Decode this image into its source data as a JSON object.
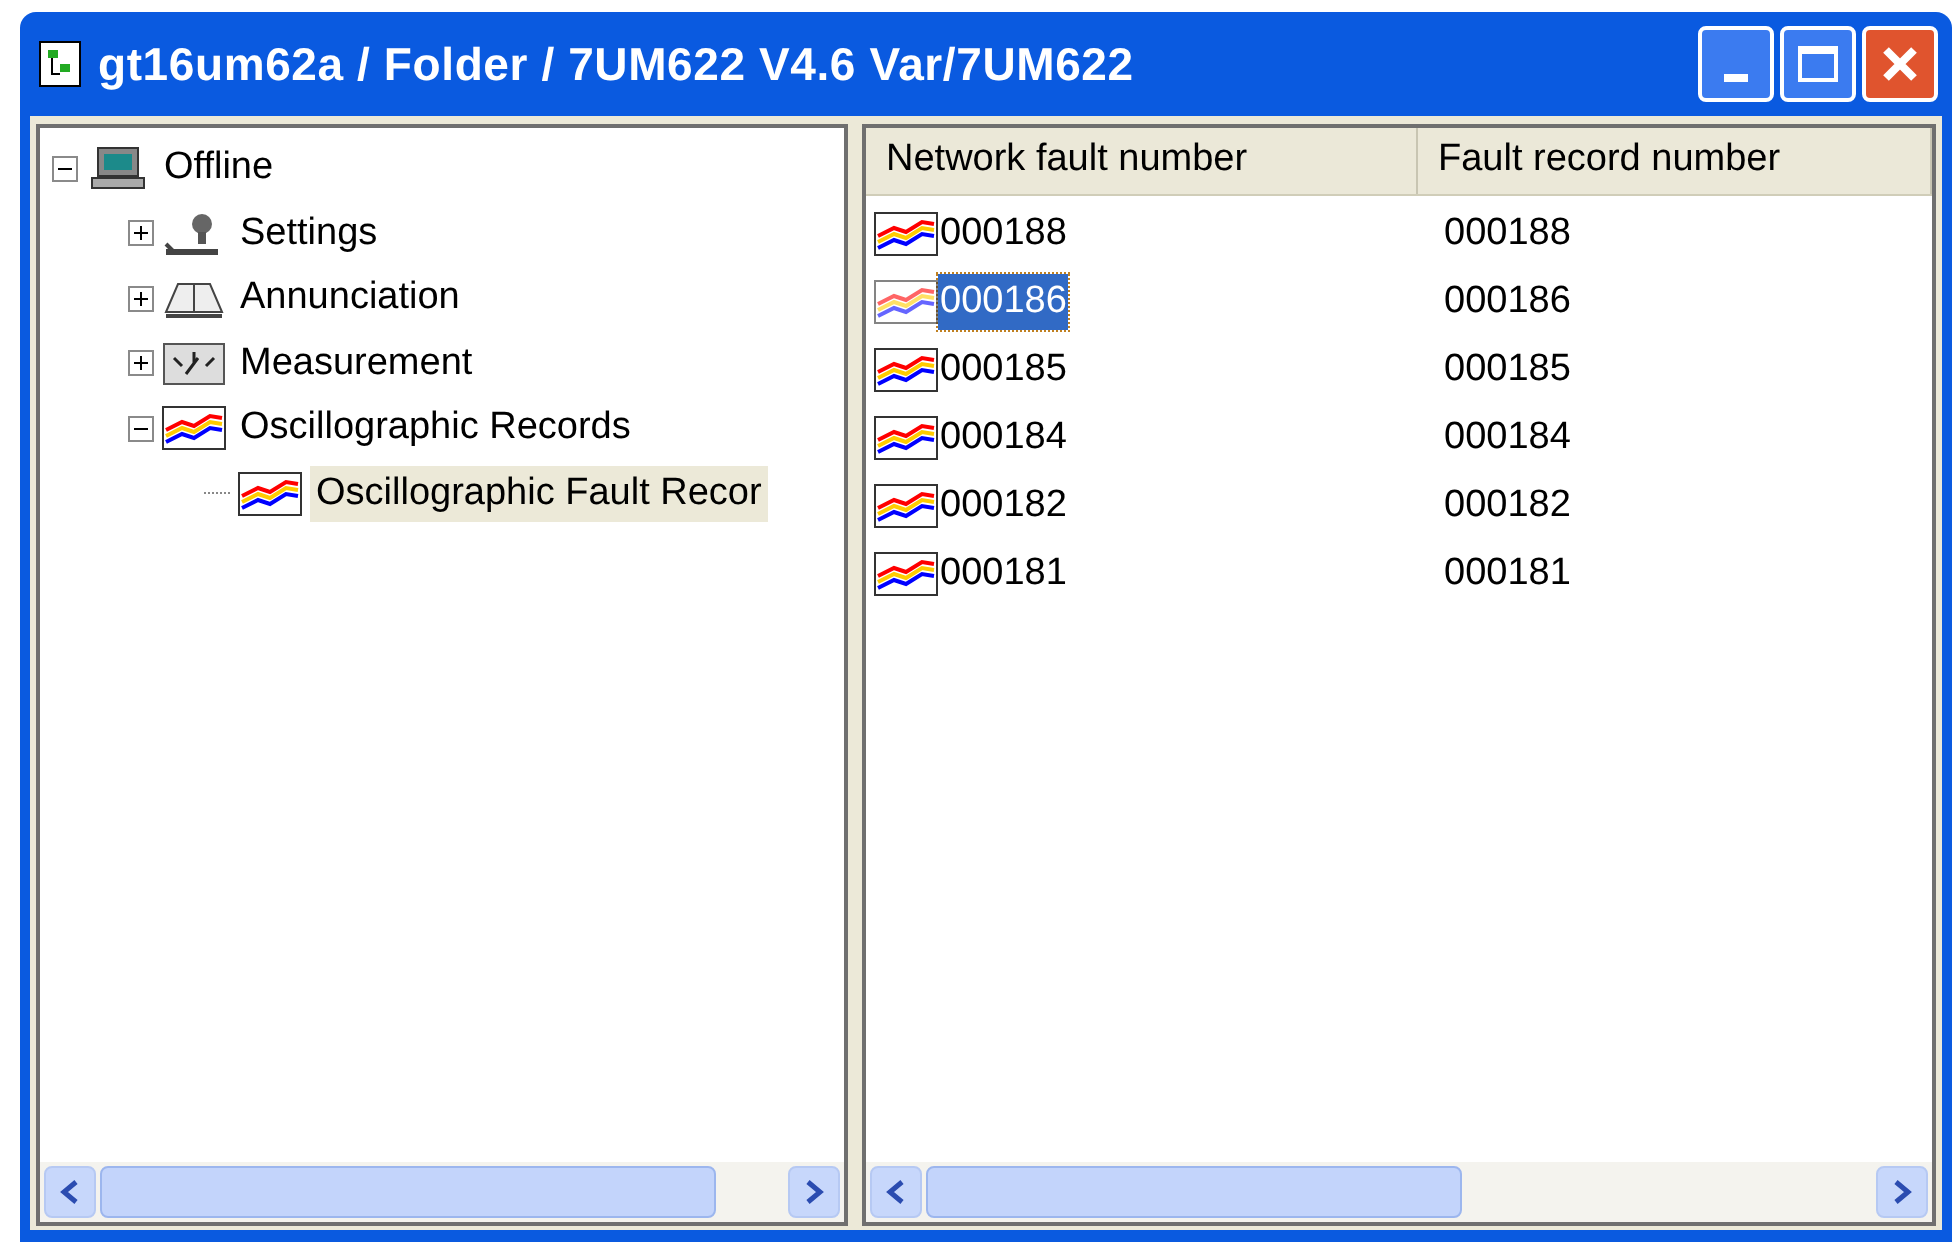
{
  "window": {
    "title": "gt16um62a / Folder / 7UM622 V4.6 Var/7UM622"
  },
  "tree": [
    {
      "label": "Offline",
      "kind": "computer",
      "expanded": true,
      "selected": false,
      "children": [
        {
          "label": "Settings",
          "kind": "settings",
          "expanded": false,
          "selected": false
        },
        {
          "label": "Annunciation",
          "kind": "book",
          "expanded": false,
          "selected": false
        },
        {
          "label": "Measurement",
          "kind": "meter",
          "expanded": false,
          "selected": false
        },
        {
          "label": "Oscillographic Records",
          "kind": "chart",
          "expanded": true,
          "selected": false,
          "children": [
            {
              "label": "Oscillographic Fault Recor",
              "kind": "chart",
              "selected": true
            }
          ]
        }
      ]
    }
  ],
  "table": {
    "columns": [
      "Network fault number",
      "Fault record number"
    ],
    "rows": [
      {
        "cells": [
          "000188",
          "000188"
        ],
        "selected": false
      },
      {
        "cells": [
          "000186",
          "000186"
        ],
        "selected": true
      },
      {
        "cells": [
          "000185",
          "000185"
        ],
        "selected": false
      },
      {
        "cells": [
          "000184",
          "000184"
        ],
        "selected": false
      },
      {
        "cells": [
          "000182",
          "000182"
        ],
        "selected": false
      },
      {
        "cells": [
          "000181",
          "000181"
        ],
        "selected": false
      }
    ]
  }
}
